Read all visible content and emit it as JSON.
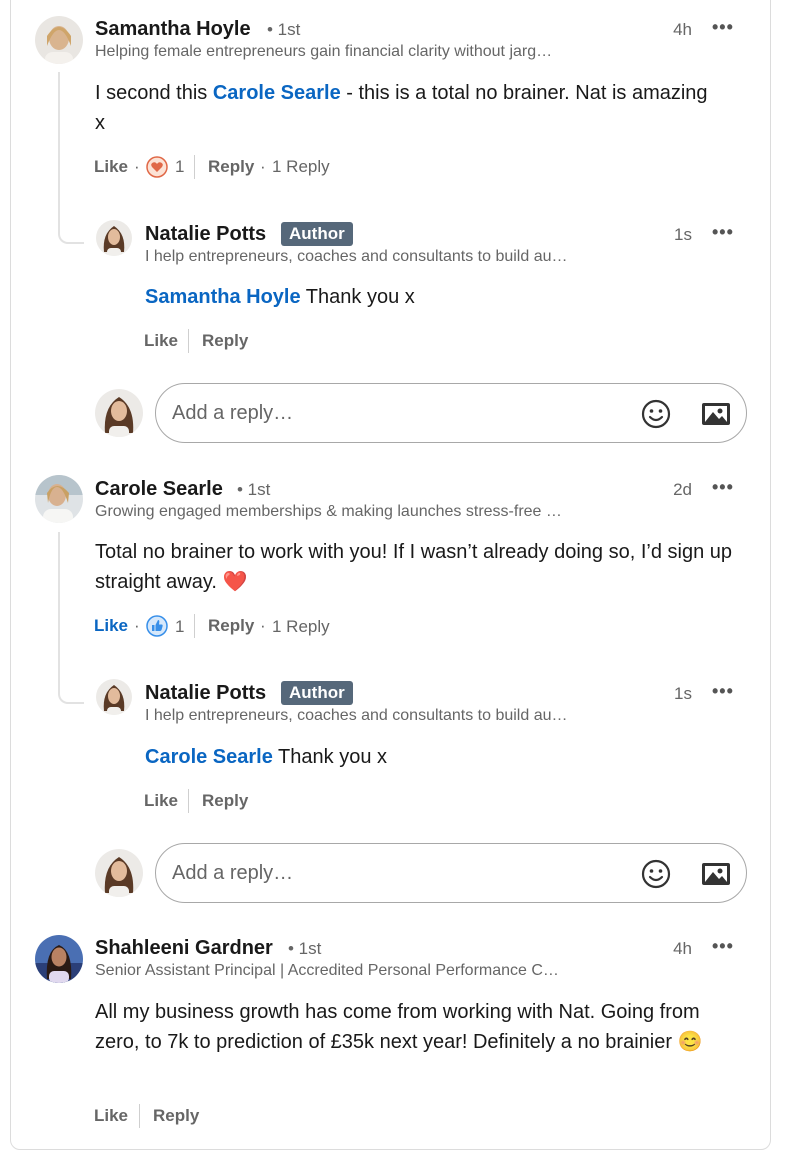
{
  "comments": [
    {
      "author": "Samantha Hoyle",
      "degree": "• 1st",
      "headline": "Helping female entrepreneurs gain financial clarity without jarg…",
      "time": "4h",
      "mention": "Carole Searle",
      "text_before": "I second this ",
      "text_after": " - this is a total no brainer. Nat is amazing x",
      "like_label": "Like",
      "reaction_count": "1",
      "reply_label": "Reply",
      "replies_count": "1 Reply",
      "reaction_icon": "heart-reaction-icon",
      "reply": {
        "author": "Natalie Potts",
        "badge": "Author",
        "headline": "I help entrepreneurs, coaches and consultants to build au…",
        "time": "1s",
        "mention": "Samantha Hoyle",
        "text": " Thank you x",
        "like_label": "Like",
        "reply_label": "Reply"
      },
      "reply_input_placeholder": "Add a reply…"
    },
    {
      "author": "Carole Searle",
      "degree": "• 1st",
      "headline": "Growing engaged memberships & making launches stress-free …",
      "time": "2d",
      "text": "Total no brainer to work with you! If I wasn’t already doing so, I’d sign up straight away. ❤️",
      "like_label": "Like",
      "reaction_count": "1",
      "reply_label": "Reply",
      "replies_count": "1 Reply",
      "reaction_icon": "like-reaction-icon",
      "reply": {
        "author": "Natalie Potts",
        "badge": "Author",
        "headline": "I help entrepreneurs, coaches and consultants to build au…",
        "time": "1s",
        "mention": "Carole Searle",
        "text": " Thank you x",
        "like_label": "Like",
        "reply_label": "Reply"
      },
      "reply_input_placeholder": "Add a reply…"
    },
    {
      "author": "Shahleeni Gardner",
      "degree": "• 1st",
      "headline": "Senior Assistant Principal | Accredited Personal Performance C…",
      "time": "4h",
      "text": "All my business growth has come from working with Nat. Going from zero, to 7k to prediction of £35k next year! Definitely a no brainier 😊",
      "like_label": "Like",
      "reply_label": "Reply"
    }
  ],
  "colors": {
    "link_blue": "#0a66c2",
    "badge_gray": "#56687a",
    "muted_text": "#666666"
  }
}
